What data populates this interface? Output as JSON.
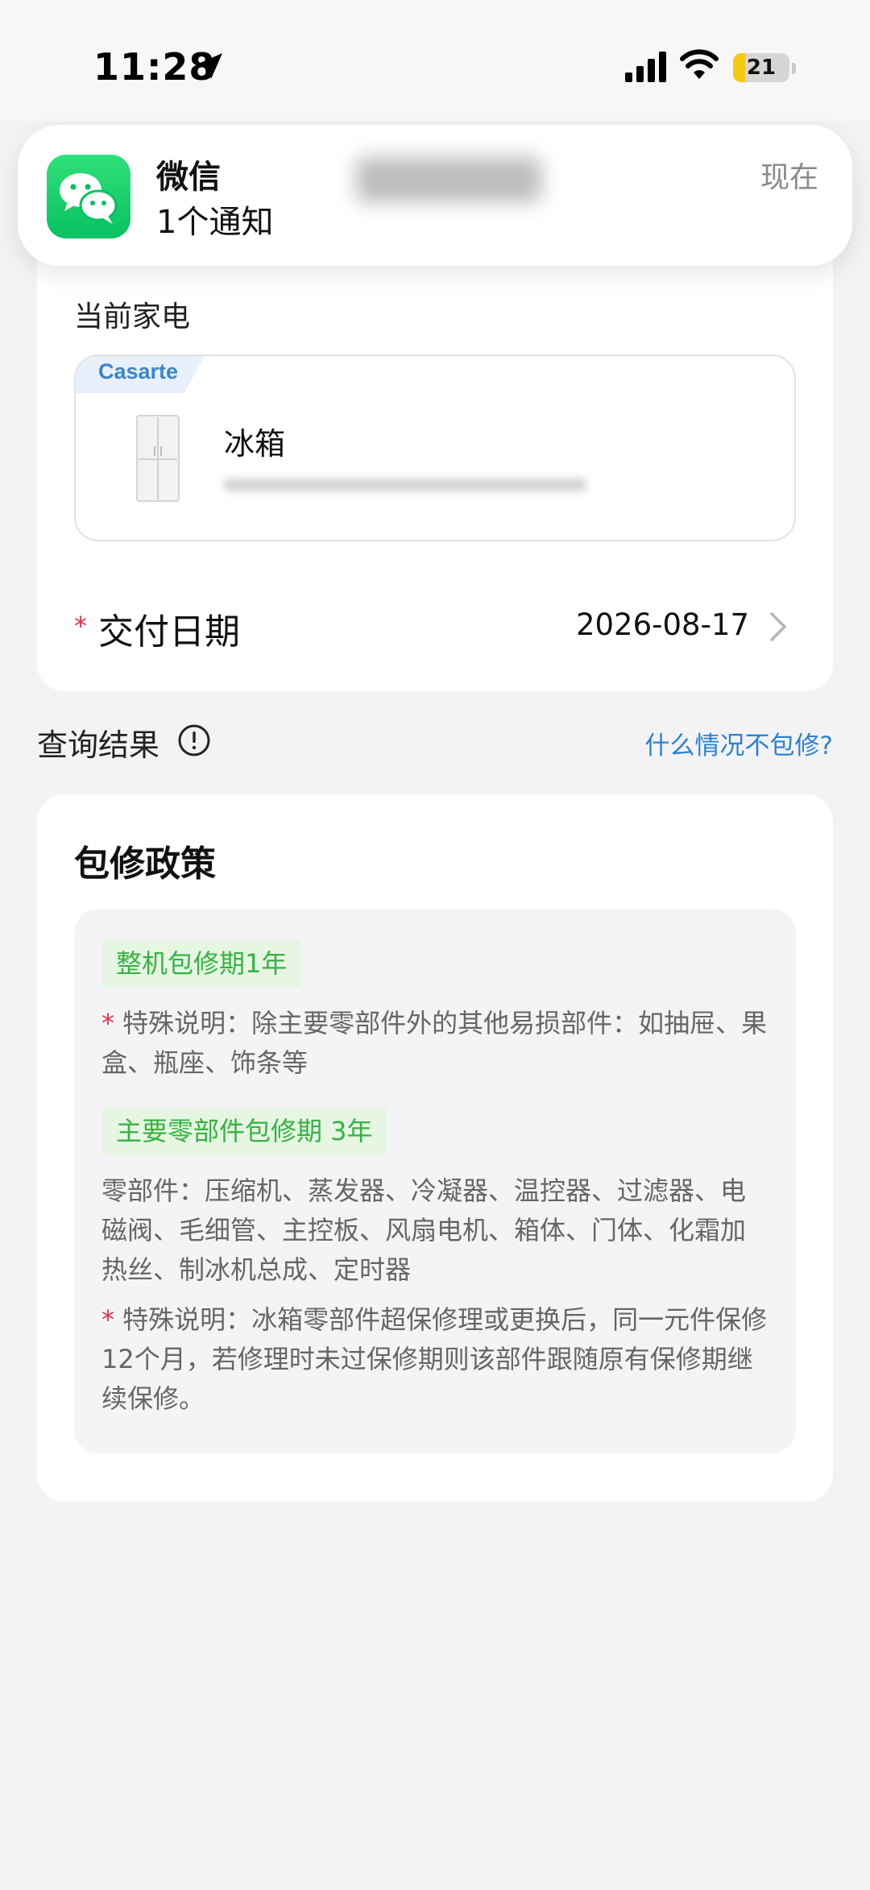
{
  "status_bar": {
    "time": "11:28",
    "battery_level": "21",
    "battery_fraction": 0.21,
    "icons": [
      "location-arrow-icon",
      "signal-icon",
      "wifi-icon",
      "battery-icon"
    ]
  },
  "notification": {
    "app_name": "微信",
    "body": "1个通知",
    "time": "现在",
    "icon": "wechat-icon"
  },
  "current_appliance": {
    "section_label": "当前家电",
    "brand": "Casarte",
    "name": "冰箱",
    "icon": "fridge-icon"
  },
  "delivery": {
    "required_mark": "*",
    "label": "交付日期",
    "value": "2026-08-17",
    "icon": "chevron-right-icon"
  },
  "query": {
    "label": "查询结果",
    "icon": "info-icon",
    "link": "什么情况不包修?"
  },
  "policy": {
    "title": "包修政策",
    "whole_tag": "整机包修期1年",
    "whole_note_star": "*",
    "whole_note": " 特殊说明：除主要零部件外的其他易损部件：如抽屉、果盒、瓶座、饰条等",
    "parts_tag": "主要零部件包修期 3年",
    "parts_list": "零部件：压缩机、蒸发器、冷凝器、温控器、过滤器、电磁阀、毛细管、主控板、风扇电机、箱体、门体、化霜加热丝、制冰机总成、定时器",
    "parts_note_star": "*",
    "parts_note": " 特殊说明：冰箱零部件超保修理或更换后，同一元件保修12个月，若修理时未过保修期则该部件跟随原有保修期继续保修。"
  },
  "colors": {
    "accent_link": "#2a82d3",
    "required": "#e0304a",
    "green_tag_text": "#35b341",
    "green_tag_bg": "#e6f6e3",
    "wechat": "#08c160",
    "battery": "#f5c90f"
  }
}
